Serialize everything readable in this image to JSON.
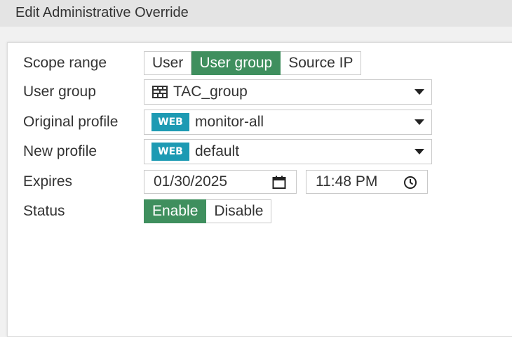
{
  "window": {
    "title": "Edit Administrative Override"
  },
  "form": {
    "scope_range": {
      "label": "Scope range",
      "options": [
        "User",
        "User group",
        "Source IP"
      ],
      "selected": "User group"
    },
    "user_group": {
      "label": "User group",
      "icon": "group-icon",
      "value": "TAC_group"
    },
    "original_profile": {
      "label": "Original profile",
      "badge": "WEB",
      "value": "monitor-all"
    },
    "new_profile": {
      "label": "New profile",
      "badge": "WEB",
      "value": "default"
    },
    "expires": {
      "label": "Expires",
      "date": "01/30/2025",
      "time": "11:48 PM"
    },
    "status": {
      "label": "Status",
      "options": [
        "Enable",
        "Disable"
      ],
      "selected": "Enable"
    }
  },
  "colors": {
    "active": "#3f8f5e",
    "badge": "#1d9ab3"
  }
}
